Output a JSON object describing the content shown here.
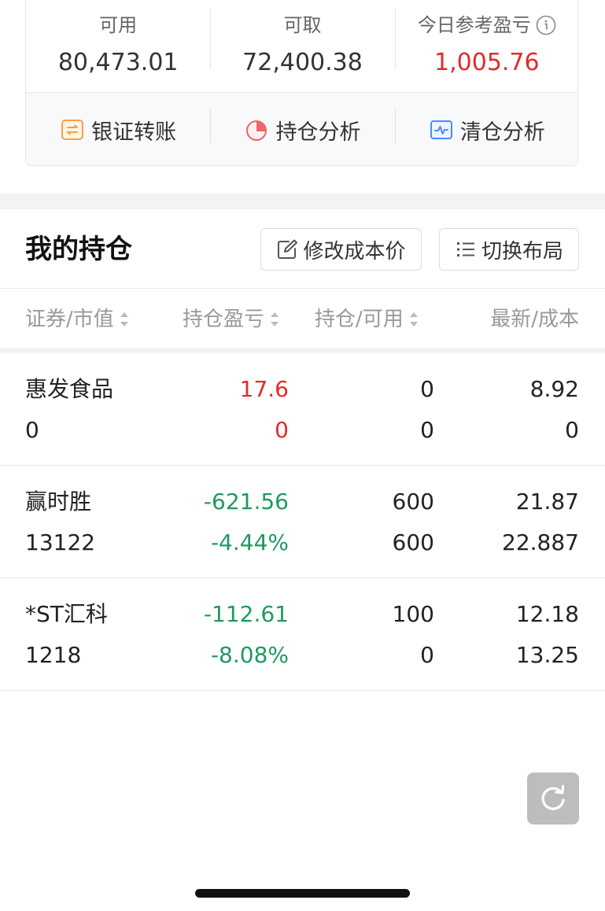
{
  "account": {
    "available_label": "可用",
    "available_value": "80,473.01",
    "withdrawable_label": "可取",
    "withdrawable_value": "72,400.38",
    "today_pnl_label": "今日参考盈亏",
    "today_pnl_value": "1,005.76"
  },
  "actions": [
    {
      "label": "银证转账",
      "icon": "bank-transfer-icon"
    },
    {
      "label": "持仓分析",
      "icon": "pie-chart-icon"
    },
    {
      "label": "清仓分析",
      "icon": "line-chart-icon"
    }
  ],
  "holdings": {
    "title": "我的持仓",
    "edit_cost_label": "修改成本价",
    "switch_layout_label": "切换布局"
  },
  "columns": {
    "security_value": "证券/市值",
    "pnl": "持仓盈亏",
    "position_available": "持仓/可用",
    "latest_cost": "最新/成本"
  },
  "rows": [
    {
      "name": "惠发食品",
      "market_value": "0",
      "pnl": "17.6",
      "pnl_pct": "0",
      "position": "0",
      "available": "0",
      "latest": "8.92",
      "cost": "0"
    },
    {
      "name": "赢时胜",
      "market_value": "13122",
      "pnl": "-621.56",
      "pnl_pct": "-4.44%",
      "position": "600",
      "available": "600",
      "latest": "21.87",
      "cost": "22.887"
    },
    {
      "name": "*ST汇科",
      "market_value": "1218",
      "pnl": "-112.61",
      "pnl_pct": "-8.08%",
      "position": "100",
      "available": "0",
      "latest": "12.18",
      "cost": "13.25"
    }
  ],
  "colors": {
    "gain": "#e12b2b",
    "loss": "#1e9a5f"
  }
}
